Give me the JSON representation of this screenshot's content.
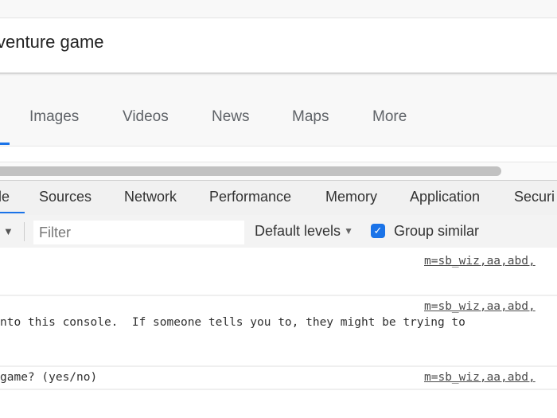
{
  "search": {
    "query_visible": "venture game"
  },
  "google_tabs": {
    "items": [
      {
        "label": "Images"
      },
      {
        "label": "Videos"
      },
      {
        "label": "News"
      },
      {
        "label": "Maps"
      },
      {
        "label": "More"
      }
    ],
    "active_color": "#1a73e8"
  },
  "devtools": {
    "tabs": [
      {
        "label": "le",
        "active": true
      },
      {
        "label": "Sources"
      },
      {
        "label": "Network"
      },
      {
        "label": "Performance"
      },
      {
        "label": "Memory"
      },
      {
        "label": "Application"
      },
      {
        "label": "Securi"
      }
    ],
    "toolbar": {
      "context_arrow": "▼",
      "filter_placeholder": "Filter",
      "filter_value": "",
      "levels_label": "Default levels",
      "levels_arrow": "▼",
      "group_similar_label": "Group similar",
      "group_similar_checked": true,
      "checkmark": "✓"
    },
    "console": {
      "messages": [
        {
          "text": "",
          "source": "m=sb_wiz,aa,abd,"
        },
        {
          "text": "nto this console.  If someone tells you to, they might be trying to",
          "source": "m=sb_wiz,aa,abd,"
        },
        {
          "text": "game? (yes/no)",
          "source": "m=sb_wiz,aa,abd,"
        }
      ]
    }
  }
}
